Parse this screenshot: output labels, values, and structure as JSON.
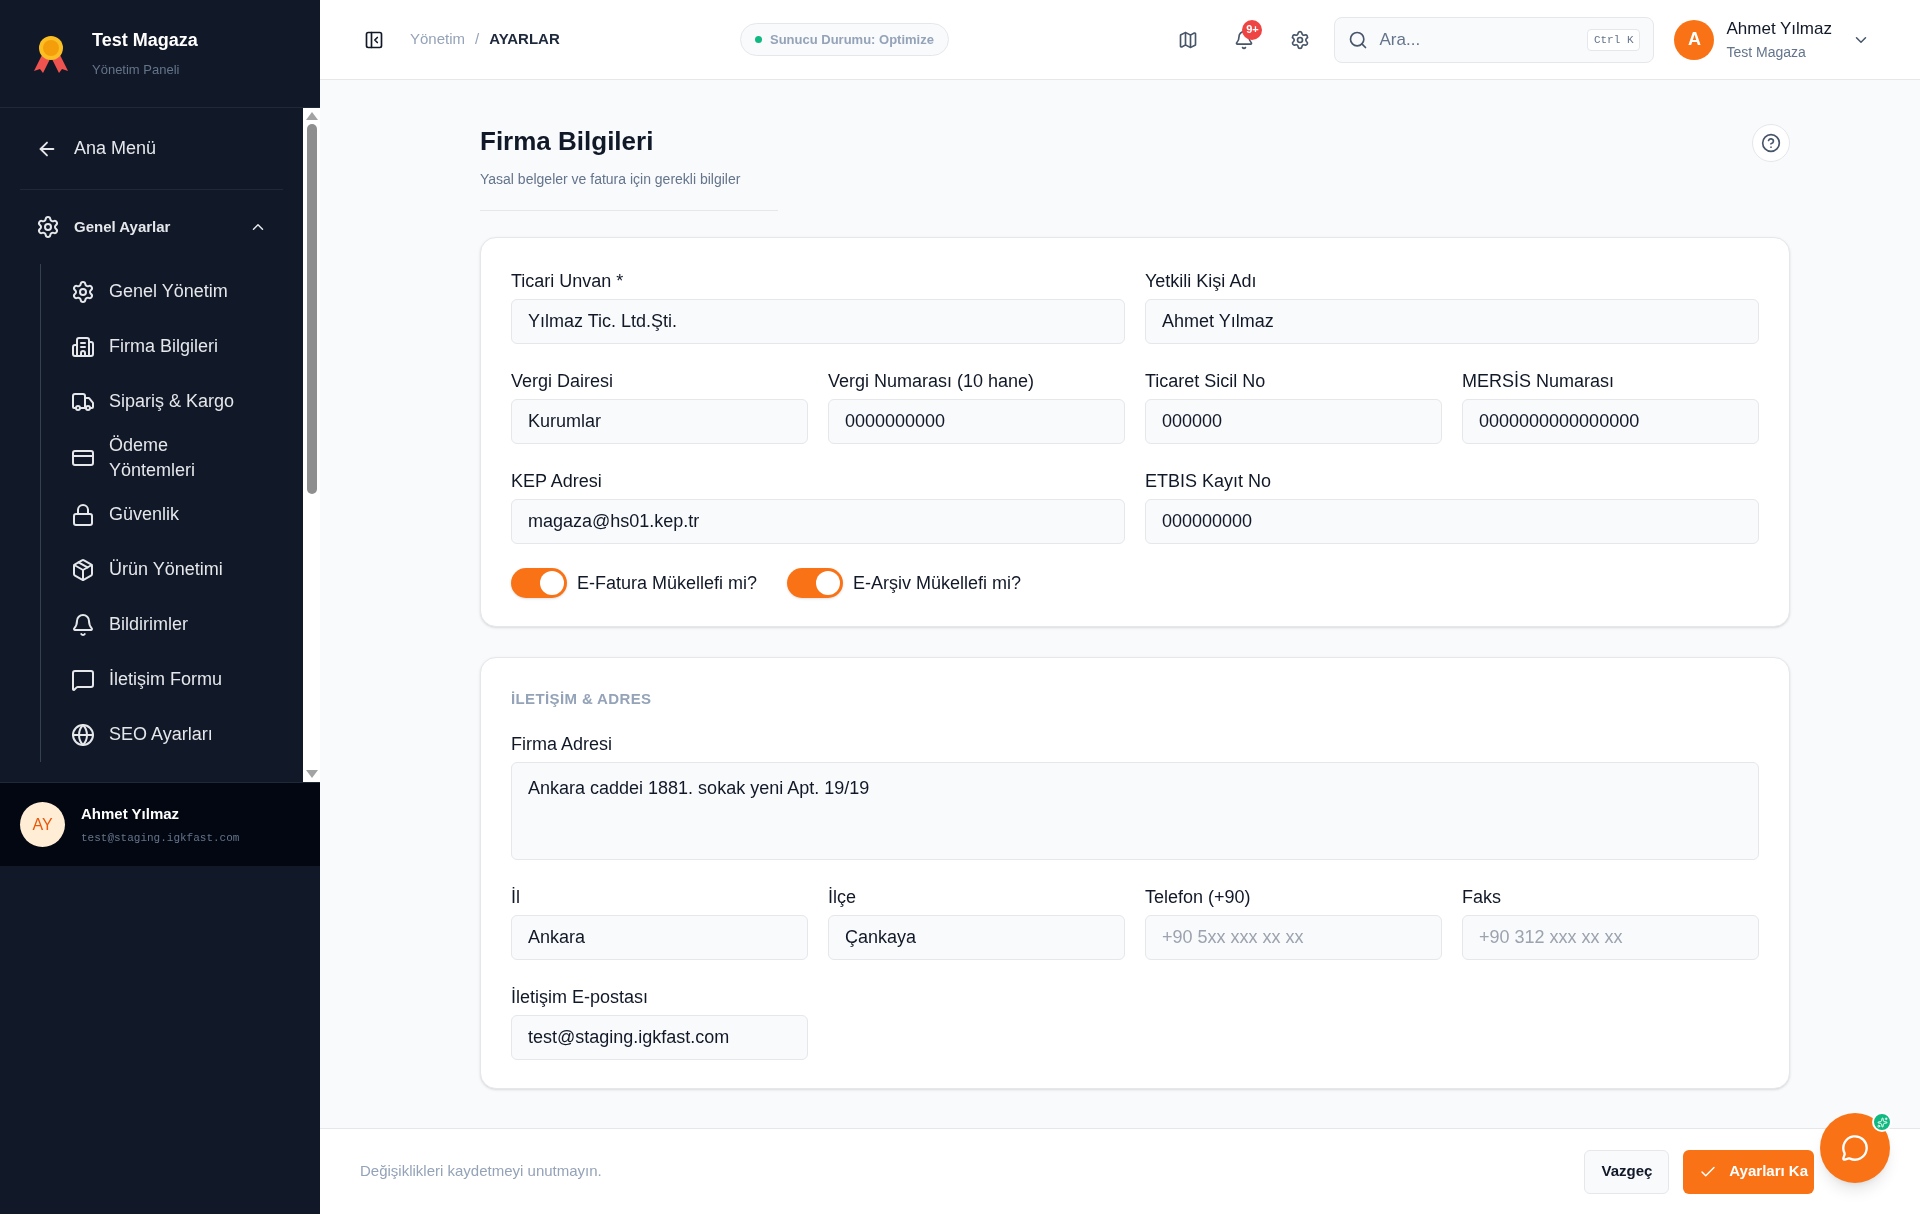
{
  "sidebar": {
    "brand": {
      "title": "Test Magaza",
      "subtitle": "Yönetim Paneli"
    },
    "back": "Ana Menü",
    "group": {
      "label": "Genel Ayarlar",
      "expanded": true,
      "children": [
        {
          "label": "Genel Yönetim"
        },
        {
          "label": "Firma Bilgileri"
        },
        {
          "label": "Sipariş & Kargo"
        },
        {
          "label": "Ödeme Yöntemleri"
        },
        {
          "label": "Güvenlik"
        },
        {
          "label": "Ürün Yönetimi"
        },
        {
          "label": "Bildirimler"
        },
        {
          "label": "İletişim Formu"
        },
        {
          "label": "SEO Ayarları"
        }
      ]
    },
    "user": {
      "initials": "AY",
      "name": "Ahmet Yılmaz",
      "email": "test@staging.igkfast.com"
    }
  },
  "header": {
    "breadcrumb": [
      "Yönetim",
      "AYARLAR"
    ],
    "separator": "/",
    "status": "Sunucu Durumu: Optimize",
    "notification_badge": "9+",
    "search": {
      "placeholder": "Ara...",
      "shortcut": "Ctrl K"
    },
    "user": {
      "initial": "A",
      "name": "Ahmet Yılmaz",
      "store": "Test Magaza"
    }
  },
  "page": {
    "title": "Firma Bilgileri",
    "subtitle": "Yasal belgeler ve fatura için gerekli bilgiler"
  },
  "sections": [
    {
      "fields": [
        {
          "label": "Ticari Unvan *",
          "value": "Yılmaz Tic. Ltd.Şti.",
          "kind": "wide"
        },
        {
          "label": "Yetkili Kişi Adı",
          "value": "Ahmet Yılmaz",
          "kind": "wide"
        },
        {
          "label": "Vergi Dairesi",
          "value": "Kurumlar",
          "kind": "narrow"
        },
        {
          "label": "Vergi Numarası (10 hane)",
          "value": "0000000000",
          "kind": "narrow"
        },
        {
          "label": "Ticaret Sicil No",
          "value": "000000",
          "kind": "narrow"
        },
        {
          "label": "MERSİS Numarası",
          "value": "0000000000000000",
          "kind": "narrow"
        },
        {
          "label": "KEP Adresi",
          "value": "magaza@hs01.kep.tr",
          "kind": "wide"
        },
        {
          "label": "ETBIS Kayıt No",
          "value": "000000000",
          "kind": "wide"
        }
      ],
      "toggles": [
        {
          "label": "E-Fatura Mükellefi mi?",
          "on": true
        },
        {
          "label": "E-Arşiv Mükellefi mi?",
          "on": true
        }
      ]
    },
    {
      "heading": "İLETİŞİM & ADRES",
      "fields": [
        {
          "label": "Firma Adresi",
          "value": "Ankara caddei 1881. sokak yeni Apt. 19/19",
          "kind": "textarea"
        },
        {
          "label": "İl",
          "value": "Ankara",
          "kind": "narrow"
        },
        {
          "label": "İlçe",
          "value": "Çankaya",
          "kind": "narrow"
        },
        {
          "label": "Telefon (+90)",
          "placeholder": "+90 5xx xxx xx xx",
          "kind": "narrow"
        },
        {
          "label": "Faks",
          "placeholder": "+90 312 xxx xx xx",
          "kind": "narrow"
        },
        {
          "label": "İletişim E-postası",
          "value": "test@staging.igkfast.com",
          "kind": "narrow"
        }
      ]
    }
  ],
  "footer": {
    "note": "Değişiklikleri kaydetmeyi unutmayın.",
    "buttons": [
      {
        "label": "Vazgeç",
        "kind": "secondary"
      },
      {
        "label": "Ayarları Ka",
        "kind": "primary"
      }
    ]
  }
}
